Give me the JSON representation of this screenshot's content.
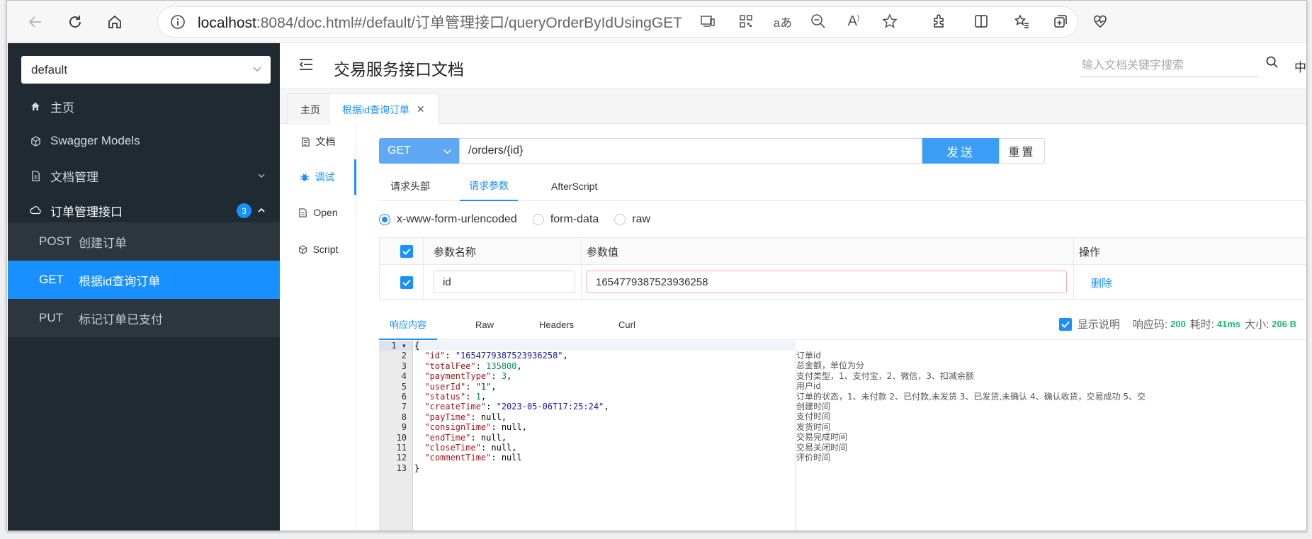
{
  "browser": {
    "url_host": "localhost",
    "url_rest": ":8084/doc.html#/default/订单管理接口/queryOrderByIdUsingGET"
  },
  "sidebar": {
    "group_select": "default",
    "items": [
      {
        "label": "主页",
        "icon": "home-icon"
      },
      {
        "label": "Swagger Models",
        "icon": "cube-icon"
      },
      {
        "label": "文档管理",
        "icon": "document-icon"
      },
      {
        "label": "订单管理接口",
        "icon": "cloud-icon",
        "badge": "3"
      }
    ],
    "subitems": [
      {
        "method": "POST",
        "label": "创建订单"
      },
      {
        "method": "GET",
        "label": "根据id查询订单"
      },
      {
        "method": "PUT",
        "label": "标记订单已支付"
      }
    ]
  },
  "header": {
    "title": "交易服务接口文档",
    "search_placeholder": "输入文档关键字搜索",
    "lang": "中"
  },
  "tabs": [
    {
      "label": "主页"
    },
    {
      "label": "根据id查询订单"
    }
  ],
  "sidemenu": [
    {
      "label": "文档"
    },
    {
      "label": "调试"
    },
    {
      "label": "Open"
    },
    {
      "label": "Script"
    }
  ],
  "request": {
    "method": "GET",
    "path": "/orders/{id}",
    "send": "发送",
    "reset": "重置",
    "tabs": [
      "请求头部",
      "请求参数",
      "AfterScript"
    ],
    "content_types": [
      "x-www-form-urlencoded",
      "form-data",
      "raw"
    ],
    "params_header": {
      "name": "参数名称",
      "value": "参数值",
      "action": "操作"
    },
    "params": [
      {
        "name": "id",
        "value": "1654779387523936258",
        "action": "删除"
      }
    ]
  },
  "response": {
    "tabs": [
      "响应内容",
      "Raw",
      "Headers",
      "Curl"
    ],
    "show_desc_label": "显示说明",
    "code_label": "响应码:",
    "code": "200",
    "time_label": "耗时:",
    "time": "41ms",
    "size_label": "大小:",
    "size": "206 B",
    "line_numbers": [
      "1",
      "2",
      "3",
      "4",
      "5",
      "6",
      "7",
      "8",
      "9",
      "10",
      "11",
      "12",
      "13"
    ],
    "lines": [
      "{",
      "  \"id\": \"1654779387523936258\",",
      "  \"totalFee\": 135800,",
      "  \"paymentType\": 3,",
      "  \"userId\": \"1\",",
      "  \"status\": 1,",
      "  \"createTime\": \"2023-05-06T17:25:24\",",
      "  \"payTime\": null,",
      "  \"consignTime\": null,",
      "  \"endTime\": null,",
      "  \"closeTime\": null,",
      "  \"commentTime\": null",
      "}"
    ],
    "descriptions": [
      "订单id",
      "总金额，单位为分",
      "支付类型，1、支付宝，2、微信，3、扣减余额",
      "用户id",
      "订单的状态，1、未付款 2、已付款,未发货 3、已发货,未确认 4、确认收货，交易成功 5、交",
      "创建时间",
      "支付时间",
      "发货时间",
      "交易完成时间",
      "交易关闭时间",
      "评价时间"
    ]
  }
}
